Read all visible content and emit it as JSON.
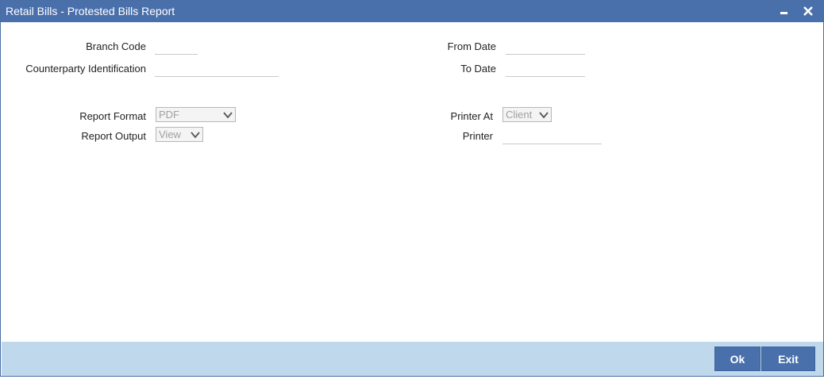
{
  "window": {
    "title": "Retail Bills - Protested Bills Report",
    "minimize_icon": "minimize-icon",
    "close_icon": "close-icon"
  },
  "form": {
    "branch_code_label": "Branch Code",
    "branch_code_value": "",
    "counterparty_label": "Counterparty Identification",
    "counterparty_value": "",
    "from_date_label": "From Date",
    "from_date_value": "",
    "to_date_label": "To Date",
    "to_date_value": "",
    "report_format_label": "Report Format",
    "report_format_value": "PDF",
    "report_output_label": "Report Output",
    "report_output_value": "View",
    "printer_at_label": "Printer At",
    "printer_at_value": "Client",
    "printer_label": "Printer",
    "printer_value": ""
  },
  "footer": {
    "ok_label": "Ok",
    "exit_label": "Exit"
  },
  "colors": {
    "titlebar": "#4a70ac",
    "footer": "#bfd8ec",
    "button": "#4a70ac"
  }
}
